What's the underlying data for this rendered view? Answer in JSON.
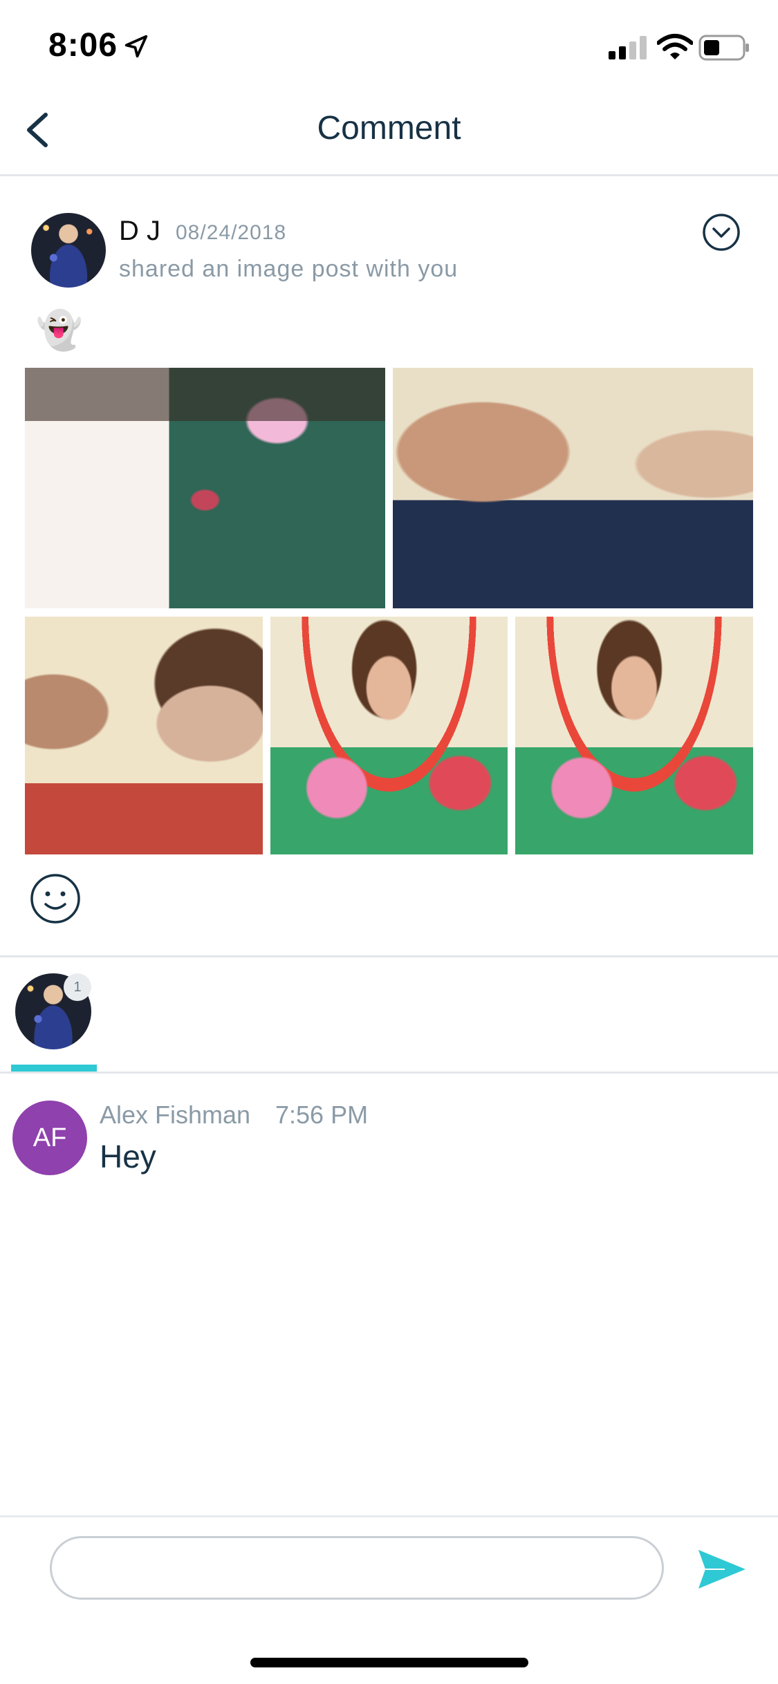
{
  "status_bar": {
    "time": "8:06"
  },
  "header": {
    "title": "Comment"
  },
  "post": {
    "author": "D J",
    "date": "08/24/2018",
    "subtitle": "shared an image post with you",
    "emoji": "👻"
  },
  "viewers_tab": {
    "count": "1"
  },
  "comment": {
    "avatar_initials": "AF",
    "author": "Alex Fishman",
    "time": "7:56 PM",
    "text": "Hey"
  },
  "input": {
    "value": "",
    "placeholder": ""
  },
  "colors": {
    "accent": "#2ec9d4",
    "avatar_bg": "#8f41ad",
    "title": "#173245",
    "muted": "#8a9aa6"
  }
}
